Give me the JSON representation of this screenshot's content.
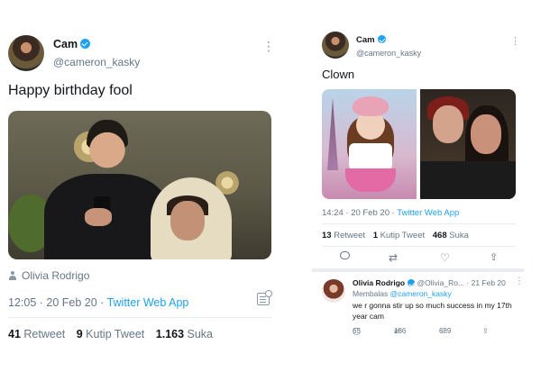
{
  "left_tweet": {
    "author_name": "Cam",
    "author_handle": "@cameron_kasky",
    "text": "Happy birthday fool",
    "tagged_user": "Olivia Rodrigo",
    "time": "12:05 · 20 Feb 20 · ",
    "source": "Twitter Web App",
    "stats": {
      "retweets_count": "41",
      "retweets_label": "Retweet",
      "quotes_count": "9",
      "quotes_label": "Kutip Tweet",
      "likes_count": "1.163",
      "likes_label": "Suka"
    },
    "icons": [
      "verified-badge-icon",
      "more-icon",
      "user-icon",
      "analytics-icon"
    ]
  },
  "right_tweet": {
    "author_name": "Cam",
    "author_handle": "@cameron_kasky",
    "text": "Clown",
    "time": "14:24 · 20 Feb 20 · ",
    "source": "Twitter Web App",
    "stats": {
      "retweets_count": "13",
      "retweets_label": "Retweet",
      "quotes_count": "1",
      "quotes_label": "Kutip Tweet",
      "likes_count": "468",
      "likes_label": "Suka"
    },
    "icons": [
      "reply-icon",
      "retweet-icon",
      "like-icon",
      "share-icon"
    ]
  },
  "reply": {
    "author_name": "Olivia Rodrigo",
    "author_handle": "@Olivia_Ro...",
    "date": "· 21 Feb 20",
    "replying_label": "Membalas ",
    "replying_to": "@cameron_kasky",
    "text": "we r gonna stir up so much success in my 17th year cam",
    "reply_count": "65",
    "retweet_count": "136",
    "like_count": "689"
  },
  "colors": {
    "accent": "#1da1f2",
    "secondary_text": "#657786",
    "primary_text": "#14171a"
  }
}
